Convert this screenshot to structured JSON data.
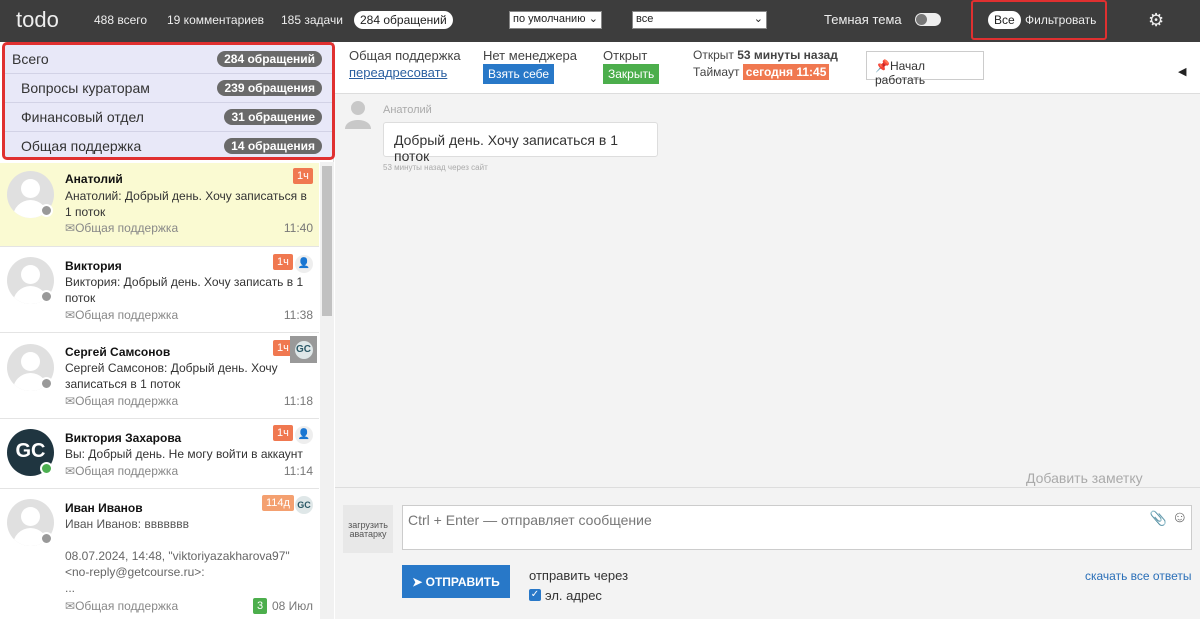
{
  "topbar": {
    "logo": "todo",
    "stat_total": "488 всего",
    "stat_comments": "19 комментариев",
    "stat_tasks": "185 задачи",
    "stat_requests": "284 обращений",
    "sort_select": "по умолчанию",
    "filter_select": "все",
    "dark_theme_label": "Темная тема",
    "all_pill": "Все",
    "filter_button": "Фильтровать"
  },
  "categories": [
    {
      "name": "Всего",
      "count": "284 обращений"
    },
    {
      "name": "Вопросы кураторам",
      "count": "239 обращения"
    },
    {
      "name": "Финансовый отдел",
      "count": "31 обращение"
    },
    {
      "name": "Общая поддержка",
      "count": "14 обращения"
    }
  ],
  "conversations": [
    {
      "name": "Анатолий",
      "message": "Анатолий: Добрый день. Хочу записаться в 1 поток",
      "dept": "Общая поддержка",
      "time": "11:40",
      "age": "1ч"
    },
    {
      "name": "Виктория",
      "message": "Виктория: Добрый день. Хочу записать в 1 поток",
      "dept": "Общая поддержка",
      "time": "11:38",
      "age": "1ч"
    },
    {
      "name": "Сергей Самсонов",
      "message": "Сергей Самсонов: Добрый день. Хочу записаться в 1 поток",
      "dept": "Общая поддержка",
      "time": "11:18",
      "age": "1ч",
      "assignee": "GC"
    },
    {
      "name": "Виктория Захарова",
      "message": "Вы: Добрый день. Не могу войти в аккаунт",
      "dept": "Общая поддержка",
      "time": "11:14",
      "age": "1ч",
      "avatar": "GC"
    },
    {
      "name": "Иван Иванов",
      "message": "Иван Иванов: ввввввв",
      "extra": "08.07.2024, 14:48, \"viktoriyazakharova97\" <no-reply@getcourse.ru>:",
      "ellipsis": "...",
      "dept": "Общая поддержка",
      "time": "08 Июл",
      "age": "114д",
      "count": "3",
      "assignee": "GC"
    }
  ],
  "header": {
    "dept": "Общая поддержка",
    "redirect": "переадресовать",
    "manager": "Нет менеджера",
    "take_button": "Взять себе",
    "status": "Открыт",
    "close_button": "Закрыть",
    "opened_prefix": "Открыт",
    "opened_value": "53 минуты назад",
    "timeout_prefix": "Таймаут",
    "timeout_value": "сегодня 11:45",
    "start_button": "Начал работать",
    "collapse_icon": "◀"
  },
  "message": {
    "author": "Анатолий",
    "text": "Добрый день. Хочу записаться в 1 поток",
    "meta": "53 минуты назад через сайт"
  },
  "note_link": "Добавить заметку",
  "compose": {
    "upload_avatar": "загрузить аватарку",
    "placeholder": "Ctrl + Enter — отправляет сообщение",
    "send_button": "ОТПРАВИТЬ",
    "send_via": "отправить через",
    "channel": "эл. адрес",
    "download_link": "скачать все ответы"
  },
  "colors": {
    "accent": "#2878c8",
    "timeout": "#f07850",
    "green": "#4cae4c",
    "highlight": "#e03030",
    "active_row": "#fafad2"
  }
}
